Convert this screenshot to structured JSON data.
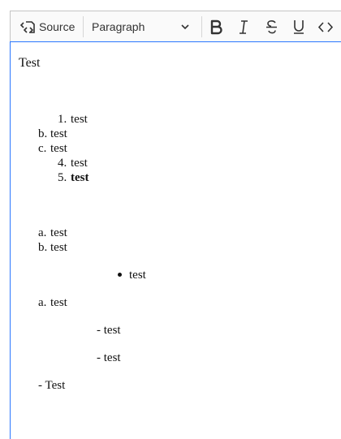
{
  "toolbar": {
    "source_label": "Source",
    "paragraph_label": "Paragraph",
    "icons": [
      "source-icon",
      "chevron-down-icon",
      "bold-icon",
      "italic-icon",
      "strikethrough-icon",
      "underline-icon",
      "code-icon"
    ]
  },
  "editor": {
    "heading_text": "Test",
    "list1": [
      {
        "marker": "1.",
        "text": "test"
      },
      {
        "marker": "b.",
        "text": "test"
      },
      {
        "marker": "c.",
        "text": "test"
      },
      {
        "marker": "4.",
        "text": "test"
      },
      {
        "marker": "5.",
        "text": "test"
      }
    ],
    "list2": [
      {
        "marker": "a.",
        "text": "test"
      },
      {
        "marker": "b.",
        "text": "test"
      }
    ],
    "bullet_item": "test",
    "list3": [
      {
        "marker": "a.",
        "text": "test"
      }
    ],
    "dash_items": [
      "- test",
      "- test"
    ],
    "dash_final": "- Test"
  },
  "colors": {
    "focus_border": "#2977ff",
    "toolbar_bg": "#fafafa"
  }
}
